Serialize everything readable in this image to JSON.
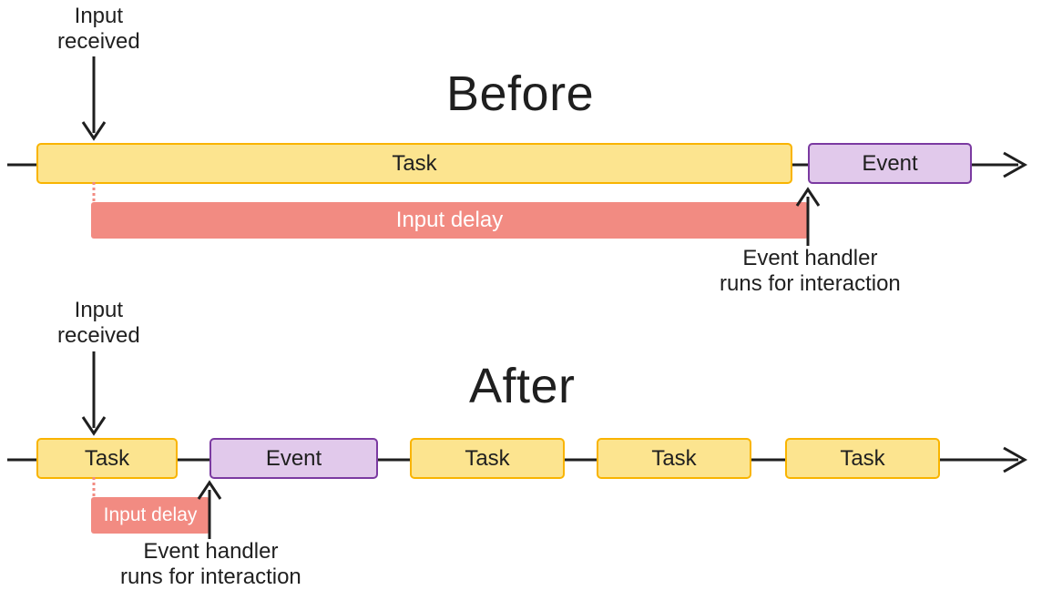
{
  "chart_data": {
    "type": "diagram",
    "title": "Task scheduling and input delay — Before vs After",
    "panels": [
      {
        "name": "Before",
        "timeline": [
          "Task (long)",
          "Event"
        ],
        "annotations": {
          "input_received_at": "early in long Task",
          "event_handler_runs_at": "start of Event block",
          "input_delay_span": "from input received to start of Event"
        },
        "input_delay_relative": "long"
      },
      {
        "name": "After",
        "timeline": [
          "Task",
          "Event",
          "Task",
          "Task",
          "Task"
        ],
        "annotations": {
          "input_received_at": "early in first short Task",
          "event_handler_runs_at": "start of Event block",
          "input_delay_span": "from input received to start of Event"
        },
        "input_delay_relative": "short"
      }
    ]
  },
  "colors": {
    "task_fill": "#fce48f",
    "task_border": "#f9b400",
    "event_fill": "#e1c9eb",
    "event_border": "#7b3aa1",
    "delay_fill": "#f28b82",
    "axis": "#1f1f1f"
  },
  "labels": {
    "before": "Before",
    "after": "After",
    "task": "Task",
    "event": "Event",
    "input_received": "Input\nreceived",
    "input_delay": "Input delay",
    "event_handler": "Event handler\nruns for interaction"
  }
}
